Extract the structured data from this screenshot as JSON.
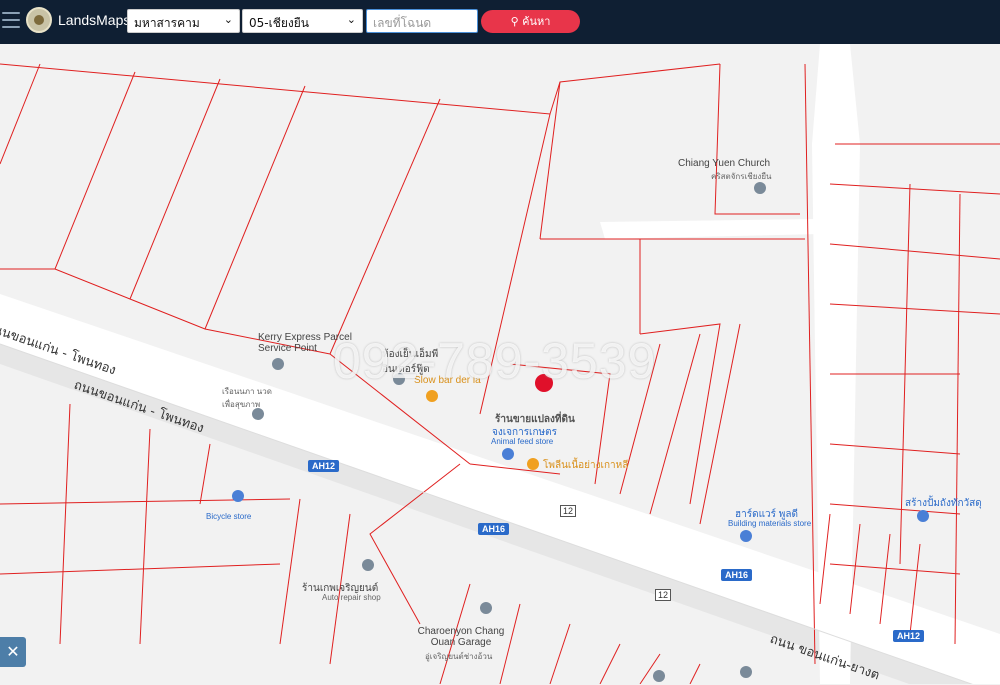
{
  "header": {
    "brand": "LandsMaps",
    "province": "มหาสารคาม",
    "district": "05-เชียงยืน",
    "deed_placeholder": "เลขที่โฉนด",
    "search_label": "ค้นหา"
  },
  "map": {
    "watermark": "092-789-3539",
    "places": {
      "church": "Chiang Yuen Church",
      "church_sub": "คริสตจักรเชียงยืน",
      "kerry": "Kerry Express Parcel Service Point",
      "shop1": "ห้องเย็นเอ็มพี อินเตอร์ฟู๊ด",
      "slowbar": "Slow bar der la",
      "massage": "เรือนนภา นวด เพื่อสุขภาพ",
      "landmark": "ร้านขายแปลงที่ดิน",
      "feed": "จงเจการเกษตร",
      "feed_sub": "Animal feed store",
      "korean": "โพลีนเนื้อย่างเกาหลี",
      "bicycle": "Bicycle store",
      "building": "ฮาร์ดแวร์ พูลดี",
      "building_sub": "Building materials store",
      "garage1": "ร้านเกพเจริญยนต์",
      "garage1_sub": "Auto repair shop",
      "garage2": "Charoenyon Chang Ouan Garage",
      "garage2_sub": "อู่เจริญยนต์ช่างอ้วน",
      "wat": "สร้างปั้มถังทักวัสดุ"
    },
    "roads": {
      "r1": "ถนนขอนแก่น - โพนทอง",
      "r2": "ถนนขอนแก่น - โพนทอง",
      "r3": "ถนน ขอนแก่น-ยางต"
    },
    "shields": [
      "AH12",
      "AH16",
      "AH16",
      "AH12"
    ],
    "route_numbers": [
      "12",
      "12"
    ]
  }
}
